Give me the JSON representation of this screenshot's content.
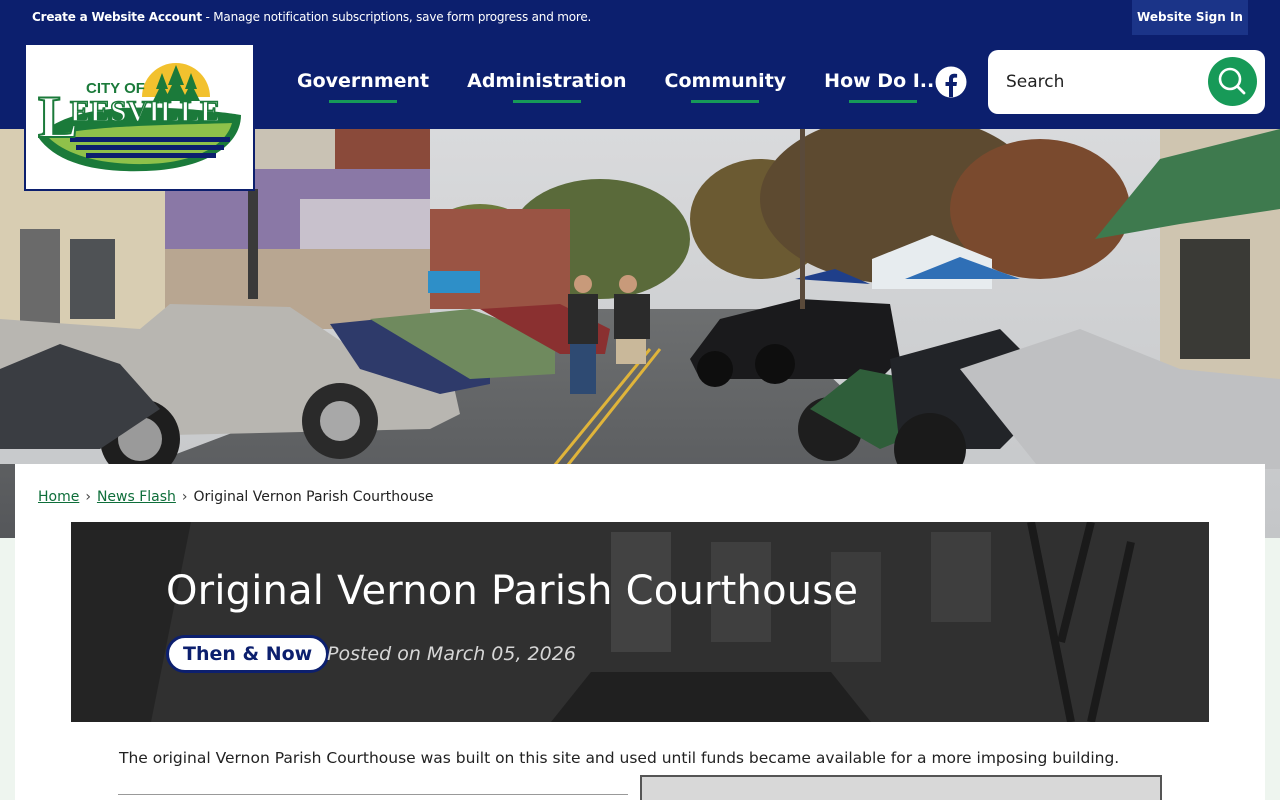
{
  "topbar": {
    "account_bold": "Create a Website Account",
    "account_rest": " - Manage notification subscriptions, save form progress and more.",
    "signin_label": "Website Sign In"
  },
  "logo": {
    "city_of": "CITY OF",
    "name": "EESVILLE",
    "initial": "L"
  },
  "nav": {
    "items": [
      {
        "label": "Government"
      },
      {
        "label": "Administration"
      },
      {
        "label": "Community"
      },
      {
        "label": "How Do I..."
      }
    ]
  },
  "social": {
    "icon": "facebook-icon"
  },
  "search": {
    "placeholder": "Search",
    "icon": "search-icon"
  },
  "breadcrumb": {
    "home": "Home",
    "section": "News Flash",
    "current": "Original Vernon Parish Courthouse",
    "separator": "›"
  },
  "article": {
    "title": "Original Vernon Parish Courthouse",
    "category": "Then & Now",
    "posted": "Posted on March 05, 2026",
    "description": "The original Vernon Parish Courthouse was built on this site and used until funds became available for a more imposing building."
  },
  "colors": {
    "navy": "#0c1f6e",
    "green": "#179a58",
    "link_green": "#0e6e3a"
  }
}
